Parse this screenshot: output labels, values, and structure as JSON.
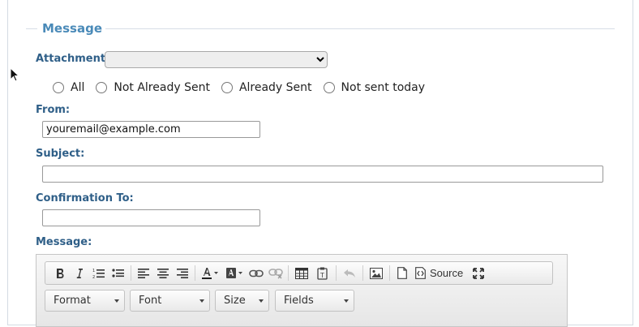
{
  "section": {
    "legend": "Message"
  },
  "attachment": {
    "label": "Attachment:",
    "selected": ""
  },
  "send_filter": {
    "options": [
      "All",
      "Not Already Sent",
      "Already Sent",
      "Not sent today"
    ]
  },
  "from": {
    "label": "From:",
    "value": "youremail@example.com"
  },
  "subject": {
    "label": "Subject:",
    "value": ""
  },
  "confirmation": {
    "label": "Confirmation To:",
    "value": ""
  },
  "message": {
    "label": "Message:"
  },
  "editor": {
    "toolbar": {
      "buttons": [
        "bold",
        "italic",
        "numbered-list",
        "bulleted-list",
        "align-left",
        "align-center",
        "align-right",
        "text-color",
        "background-color",
        "link",
        "unlink",
        "table",
        "paste-text",
        "undo",
        "image",
        "new-page",
        "source",
        "maximize"
      ],
      "source_label": "Source"
    },
    "combos": [
      "Format",
      "Font",
      "Size",
      "Fields"
    ]
  }
}
